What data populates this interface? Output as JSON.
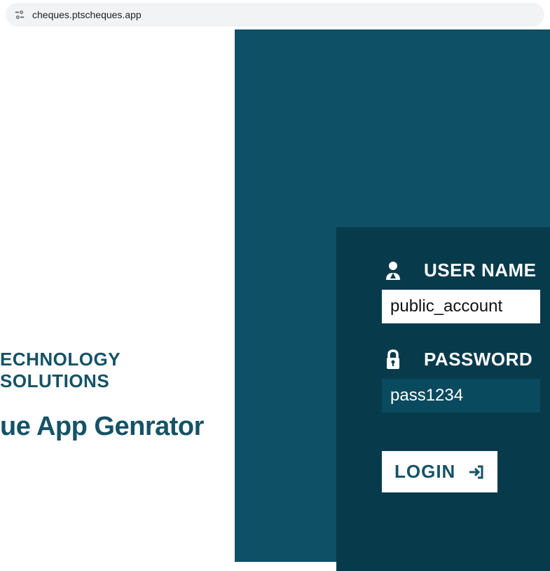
{
  "address_bar": {
    "url": "cheques.ptscheques.app"
  },
  "headings": {
    "line1": "ECHNOLOGY SOLUTIONS",
    "line2": "ue App Genrator"
  },
  "login_form": {
    "username": {
      "label": "USER NAME",
      "value": "public_account"
    },
    "password": {
      "label": "PASSWORD",
      "value": "pass1234"
    },
    "button": {
      "label": "LOGIN"
    }
  }
}
